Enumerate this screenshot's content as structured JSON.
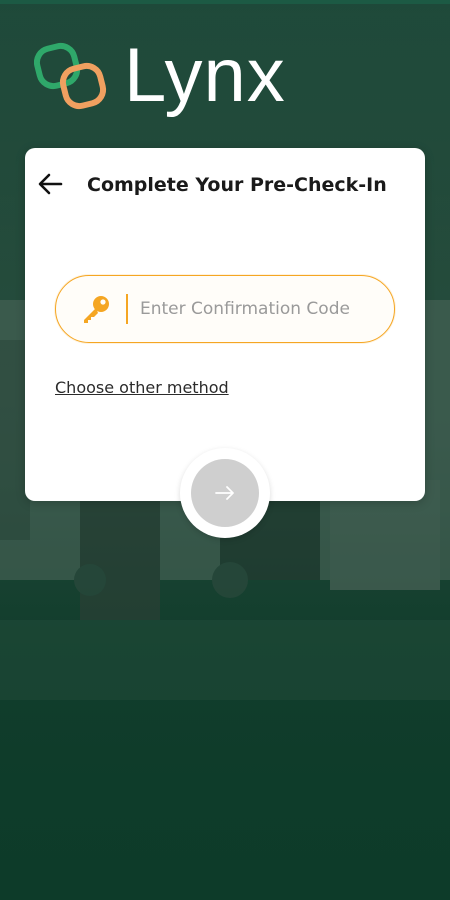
{
  "app": {
    "brand_name": "Lynx",
    "logo_icon": "linked-rings-logo",
    "colors": {
      "brand_green": "#2fa86a",
      "brand_orange": "#f0a060",
      "accent": "#f5a623",
      "background": "#0f3d2a"
    }
  },
  "card": {
    "title": "Complete Your Pre-Check-In",
    "back_icon": "arrow-left-icon",
    "code_field": {
      "icon": "key-icon",
      "placeholder": "Enter Confirmation Code",
      "value": ""
    },
    "other_method_link": "Choose other method"
  },
  "submit": {
    "icon": "arrow-right-icon",
    "state": "disabled"
  }
}
